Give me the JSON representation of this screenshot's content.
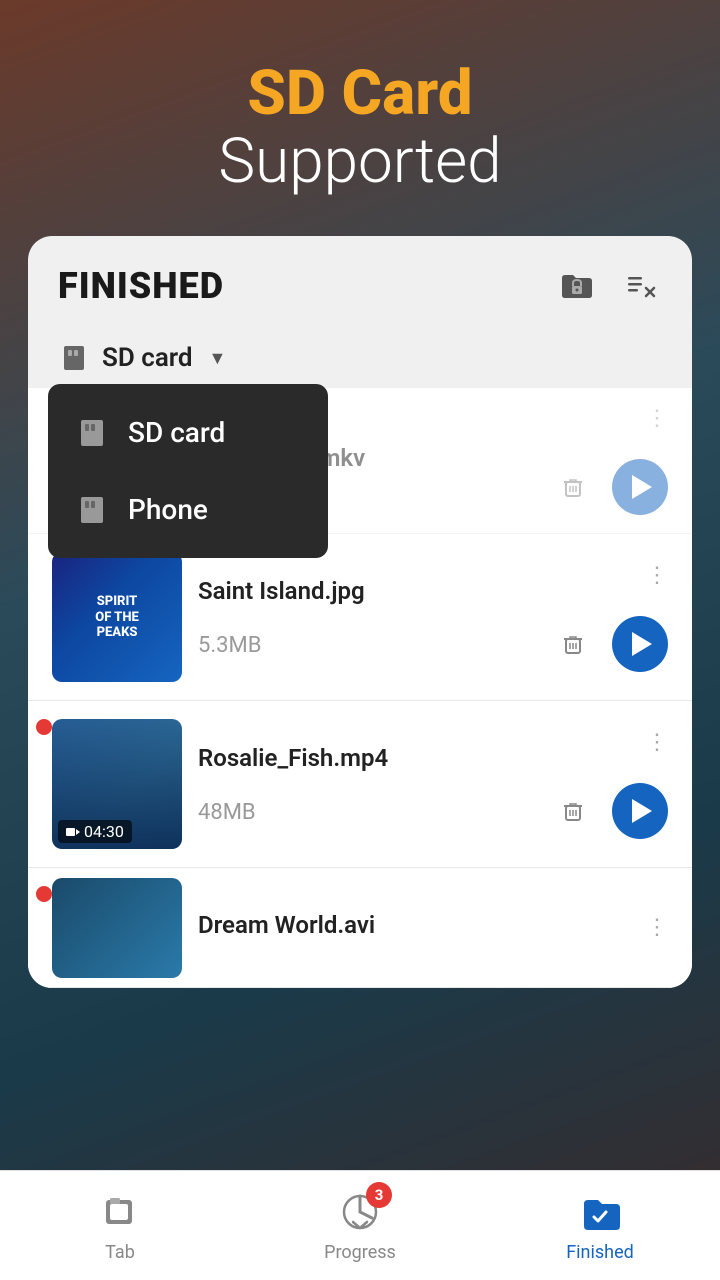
{
  "header": {
    "sdcard_label": "SD Card",
    "supported_label": "Supported"
  },
  "card": {
    "title": "FINISHED",
    "icons": {
      "folder_lock": "folder-lock-icon",
      "delete_list": "delete-list-icon"
    }
  },
  "storage_selector": {
    "current": "SD card",
    "options": [
      {
        "label": "SD card",
        "icon": "sdcard-icon"
      },
      {
        "label": "Phone",
        "icon": "phone-icon"
      }
    ]
  },
  "files": [
    {
      "name": "Sound of Y.mkv",
      "size": "",
      "type": "video",
      "thumb_type": "hidden",
      "has_dot": false
    },
    {
      "name": "Saint Island.jpg",
      "size": "5.3MB",
      "type": "image",
      "thumb_type": "poster",
      "has_dot": false,
      "duration": null
    },
    {
      "name": "Rosalie_Fish.mp4",
      "size": "48MB",
      "type": "video",
      "thumb_type": "video",
      "has_dot": true,
      "duration": "04:30"
    },
    {
      "name": "Dream World.avi",
      "size": "",
      "type": "video",
      "thumb_type": "partial",
      "has_dot": true
    }
  ],
  "tabs": [
    {
      "label": "Tab",
      "icon": "tab-icon",
      "active": false,
      "badge": null
    },
    {
      "label": "Progress",
      "icon": "progress-icon",
      "active": false,
      "badge": "3"
    },
    {
      "label": "Finished",
      "icon": "finished-icon",
      "active": true,
      "badge": null
    }
  ]
}
